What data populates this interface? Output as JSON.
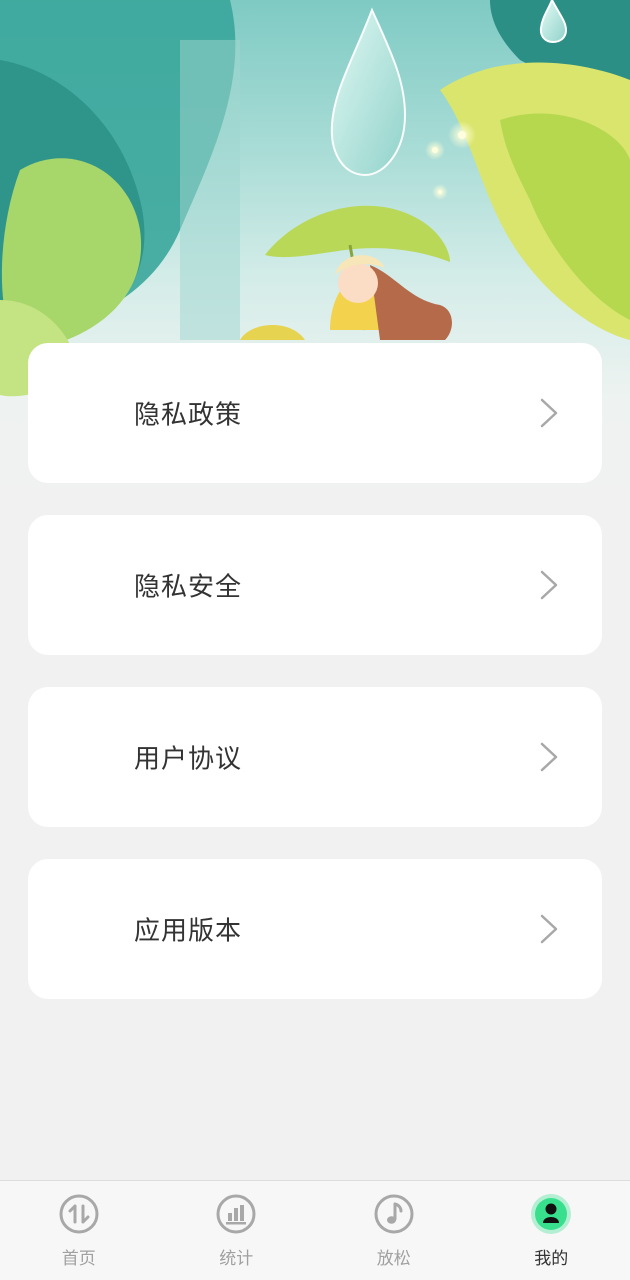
{
  "menu": {
    "items": [
      {
        "label": "隐私政策"
      },
      {
        "label": "隐私安全"
      },
      {
        "label": "用户协议"
      },
      {
        "label": "应用版本"
      }
    ]
  },
  "tabbar": {
    "tabs": [
      {
        "label": "首页",
        "icon": "home-arrows-icon",
        "active": false
      },
      {
        "label": "统计",
        "icon": "stats-icon",
        "active": false
      },
      {
        "label": "放松",
        "icon": "music-note-icon",
        "active": false
      },
      {
        "label": "我的",
        "icon": "profile-icon",
        "active": true
      }
    ],
    "active_color": "#38e08e",
    "inactive_color": "#a0a0a0"
  }
}
